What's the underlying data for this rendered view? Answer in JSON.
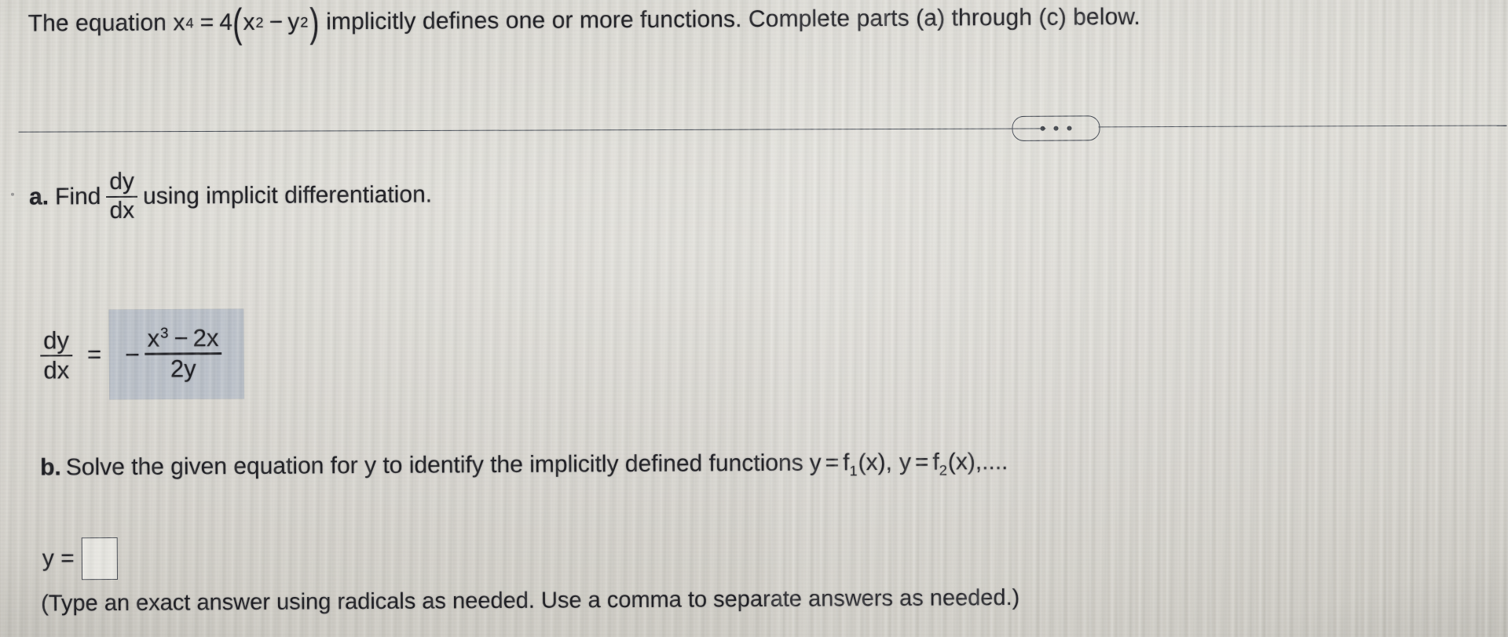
{
  "problem": {
    "statement_prefix": "The equation ",
    "equation": {
      "lhs_base": "x",
      "lhs_exp": "4",
      "equals": "=",
      "coefficient": "4",
      "paren_open": "(",
      "term1_base": "x",
      "term1_exp": "2",
      "minus": "−",
      "term2_base": "y",
      "term2_exp": "2",
      "paren_close": ")"
    },
    "statement_suffix": " implicitly defines one or more functions. Complete parts (a) through (c) below."
  },
  "toolbar": {
    "more_options_label": "• • •",
    "more_options_name": "more-options"
  },
  "part_a": {
    "label": "a.",
    "text_before": "Find",
    "derivative_num": "dy",
    "derivative_den": "dx",
    "text_after": "using implicit differentiation.",
    "answer": {
      "lhs_num": "dy",
      "lhs_den": "dx",
      "equals": "=",
      "sign": "−",
      "num_base": "x",
      "num_exp": "3",
      "num_minus": "−",
      "num_tail": "2x",
      "den": "2y",
      "box_fill_color": "#b9bfc8",
      "filled": true
    }
  },
  "part_b": {
    "label": "b.",
    "text": "Solve the given equation for y to identify the implicitly defined functions",
    "func1_y": "y",
    "func1_eq": "=",
    "func1_name": "f",
    "func1_index": "1",
    "func1_arg": "(x),",
    "func2_y": "y",
    "func2_eq": "=",
    "func2_name": "f",
    "func2_index": "2",
    "func2_arg": "(x),....",
    "answer_label": "y =",
    "answer_value": "",
    "answer_placeholder": "",
    "hint": "(Type an exact answer using radicals as needed. Use a comma to separate answers as needed.)"
  },
  "colors": {
    "background": "#d2d0c9",
    "text": "#1b1b20",
    "rule": "#2e3440",
    "answer_box": "#b9bfc8",
    "input_border": "#41454d",
    "input_fill": "#e7e6e1"
  }
}
